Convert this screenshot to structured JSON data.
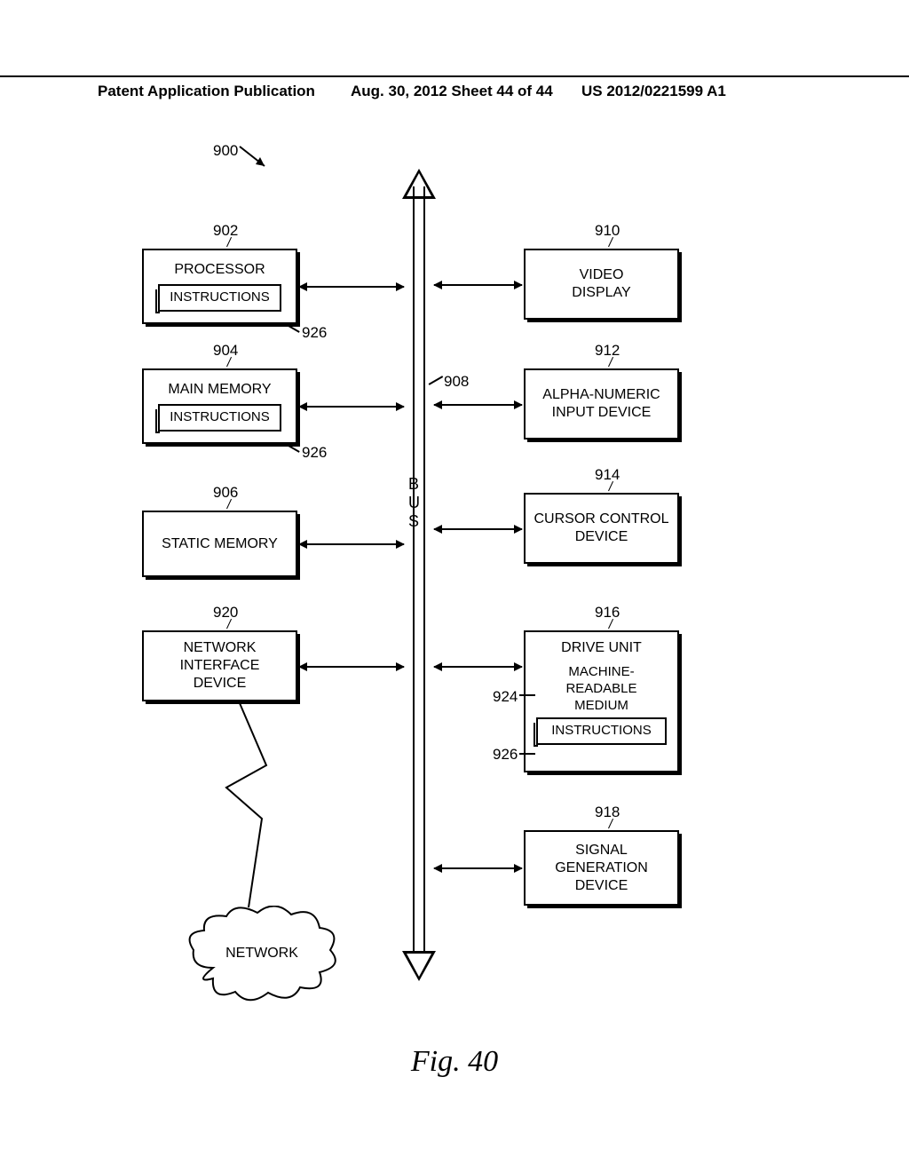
{
  "header": {
    "left": "Patent Application Publication",
    "mid": "Aug. 30, 2012  Sheet 44 of 44",
    "right": "US 2012/0221599 A1"
  },
  "figure_label": "Fig. 40",
  "bus_label": "BUS",
  "refs": {
    "r900": "900",
    "r902": "902",
    "r904": "904",
    "r906": "906",
    "r908": "908",
    "r910": "910",
    "r912": "912",
    "r914": "914",
    "r916": "916",
    "r918": "918",
    "r920": "920",
    "r924": "924",
    "r926a": "926",
    "r926b": "926",
    "r926c": "926"
  },
  "boxes": {
    "processor": "PROCESSOR",
    "instructions": "INSTRUCTIONS",
    "main_memory": "MAIN MEMORY",
    "static_memory": "STATIC MEMORY",
    "nid": "NETWORK\nINTERFACE\nDEVICE",
    "video": "VIDEO\nDISPLAY",
    "alpha": "ALPHA-NUMERIC\nINPUT DEVICE",
    "cursor": "CURSOR CONTROL\nDEVICE",
    "drive": "DRIVE UNIT",
    "mrm": "MACHINE-\nREADABLE\nMEDIUM",
    "sig": "SIGNAL\nGENERATION\nDEVICE",
    "network": "NETWORK"
  }
}
